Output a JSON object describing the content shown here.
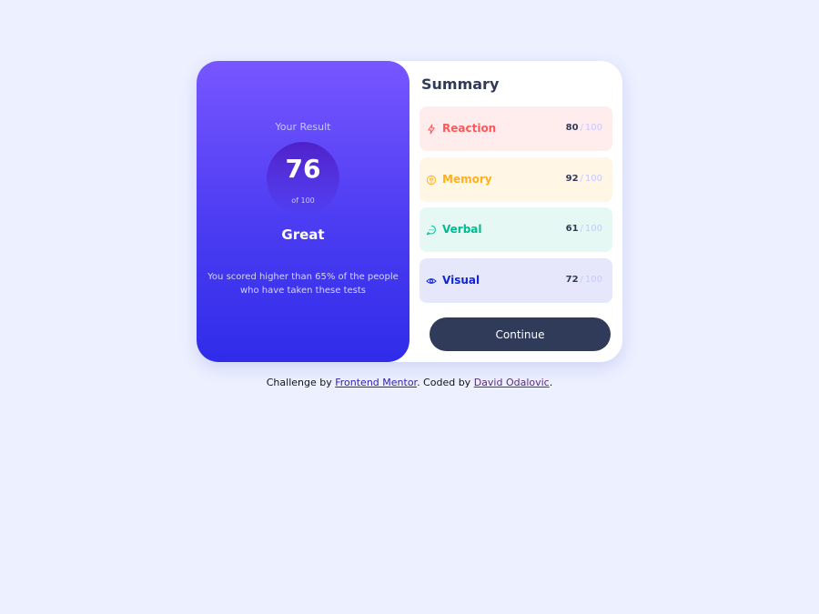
{
  "result": {
    "title": "Your Result",
    "score": "76",
    "of_label": "of 100",
    "rating": "Great",
    "description": "You scored higher than 65% of the people who have taken these tests"
  },
  "summary": {
    "title": "Summary",
    "items": [
      {
        "label": "Reaction",
        "value": "80",
        "separator": "/",
        "max": "100",
        "color": "#ff5757",
        "bg": "#ffeded",
        "icon": "lightning-icon"
      },
      {
        "label": "Memory",
        "value": "92",
        "separator": "/",
        "max": "100",
        "color": "#ffb01f",
        "bg": "#fff6e5",
        "icon": "brain-icon"
      },
      {
        "label": "Verbal",
        "value": "61",
        "separator": "/",
        "max": "100",
        "color": "#00bb8f",
        "bg": "#e5f8f4",
        "icon": "chat-bubble-icon"
      },
      {
        "label": "Visual",
        "value": "72",
        "separator": "/",
        "max": "100",
        "color": "#1125d6",
        "bg": "#e6e7fb",
        "icon": "eye-icon"
      }
    ],
    "continue_label": "Continue"
  },
  "attribution": {
    "prefix": "Challenge by",
    "challenge_link": "Frontend Mentor",
    "middle": ". Coded by",
    "author_link": "David Odalovic",
    "suffix": "."
  }
}
